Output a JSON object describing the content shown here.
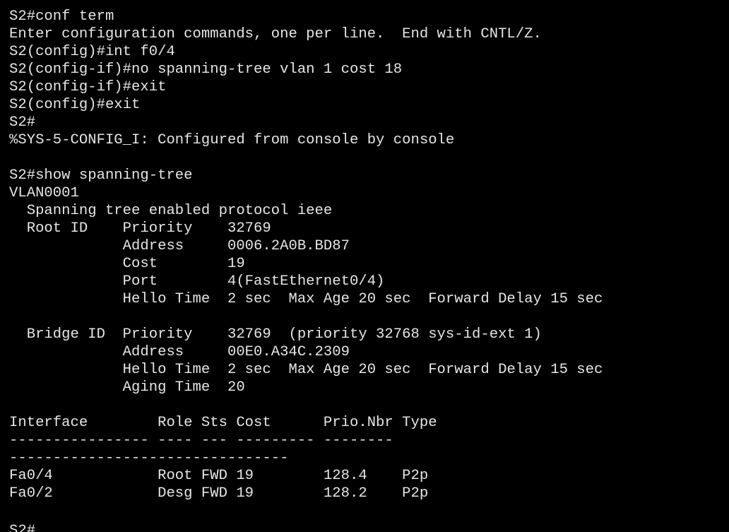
{
  "terminal": {
    "prompt_final": "S2#",
    "lines": [
      "S2#conf term",
      "Enter configuration commands, one per line.  End with CNTL/Z.",
      "S2(config)#int f0/4",
      "S2(config-if)#no spanning-tree vlan 1 cost 18",
      "S2(config-if)#exit",
      "S2(config)#exit",
      "S2#",
      "%SYS-5-CONFIG_I: Configured from console by console",
      "",
      "S2#show spanning-tree",
      "VLAN0001",
      "  Spanning tree enabled protocol ieee",
      "  Root ID    Priority    32769",
      "             Address     0006.2A0B.BD87",
      "             Cost        19",
      "             Port        4(FastEthernet0/4)",
      "             Hello Time  2 sec  Max Age 20 sec  Forward Delay 15 sec",
      "",
      "  Bridge ID  Priority    32769  (priority 32768 sys-id-ext 1)",
      "             Address     00E0.A34C.2309",
      "             Hello Time  2 sec  Max Age 20 sec  Forward Delay 15 sec",
      "             Aging Time  20",
      "",
      "Interface        Role Sts Cost      Prio.Nbr Type",
      "---------------- ---- --- --------- --------",
      "--------------------------------",
      "Fa0/4            Root FWD 19        128.4    P2p",
      "Fa0/2            Desg FWD 19        128.2    P2p",
      ""
    ]
  }
}
